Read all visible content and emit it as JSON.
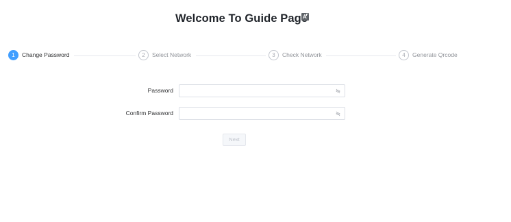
{
  "header": {
    "title": "Welcome To Guide Page",
    "language_icon": "translate-icon"
  },
  "steps": [
    {
      "number": "1",
      "label": "Change Password",
      "active": true
    },
    {
      "number": "2",
      "label": "Select Network",
      "active": false
    },
    {
      "number": "3",
      "label": "Check Network",
      "active": false
    },
    {
      "number": "4",
      "label": "Generate Qrcode",
      "active": false
    }
  ],
  "form": {
    "password": {
      "label": "Password",
      "value": "",
      "placeholder": "",
      "icon": "eye-off-icon"
    },
    "confirm_password": {
      "label": "Confirm Password",
      "value": "",
      "placeholder": "",
      "icon": "eye-off-icon"
    },
    "next_label": "Next"
  },
  "colors": {
    "accent": "#409eff",
    "inactive": "#909399",
    "border": "#dcdfe6"
  }
}
